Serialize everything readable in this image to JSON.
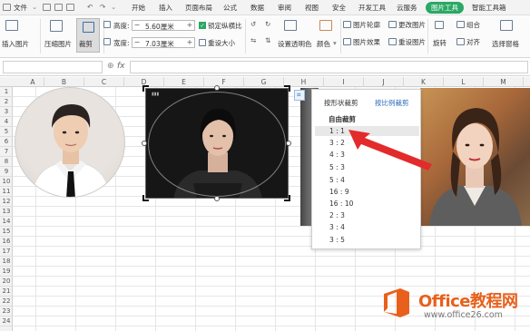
{
  "menubar": {
    "file_label": "文件",
    "tabs": [
      "开始",
      "插入",
      "页面布局",
      "公式",
      "数据",
      "审阅",
      "视图",
      "安全",
      "开发工具",
      "云服务",
      "图片工具",
      "智能工具箱"
    ]
  },
  "ribbon": {
    "insert_picture": "插入图片",
    "compress_picture": "压缩图片",
    "crop": "裁剪",
    "height_label": "高度:",
    "height_value": "5.60厘米",
    "width_label": "宽度:",
    "width_value": "7.03厘米",
    "lock_ratio": "锁定纵横比",
    "reset_size": "重设大小",
    "set_transparent": "设置透明色",
    "color": "颜色",
    "picture_outline": "图片轮廓",
    "picture_effects": "图片效果",
    "change_picture": "更改图片",
    "reset_picture": "重设图片",
    "combine": "组合",
    "rotate": "旋转",
    "align": "对齐",
    "selection_pane": "选择窗格"
  },
  "formula_bar": {
    "fx": "fx"
  },
  "grid": {
    "columns": [
      "A",
      "B",
      "C",
      "D",
      "E",
      "F",
      "G",
      "H",
      "I",
      "J",
      "K",
      "L",
      "M"
    ],
    "rows": [
      "1",
      "2",
      "3",
      "4",
      "5",
      "6",
      "7",
      "8",
      "9",
      "10",
      "11",
      "12",
      "13",
      "14",
      "15",
      "16",
      "17",
      "18",
      "19",
      "20",
      "21",
      "22",
      "23",
      "24"
    ]
  },
  "crop_popup": {
    "tab_shape": "按形状裁剪",
    "tab_ratio": "按比例裁剪",
    "section_title": "自由裁剪",
    "ratios": [
      "1 : 1",
      "3 : 2",
      "4 : 3",
      "5 : 3",
      "5 : 4",
      "16 : 9",
      "16 : 10",
      "2 : 3",
      "3 : 4",
      "3 : 5"
    ],
    "selected_index": 0
  },
  "watermark": {
    "title": "Office教程网",
    "url": "www.office26.com"
  },
  "colors": {
    "accent_green": "#2aa865",
    "arrow_red": "#e32b2b",
    "link_blue": "#2a6ebb",
    "watermark_orange": "#e8601b"
  }
}
